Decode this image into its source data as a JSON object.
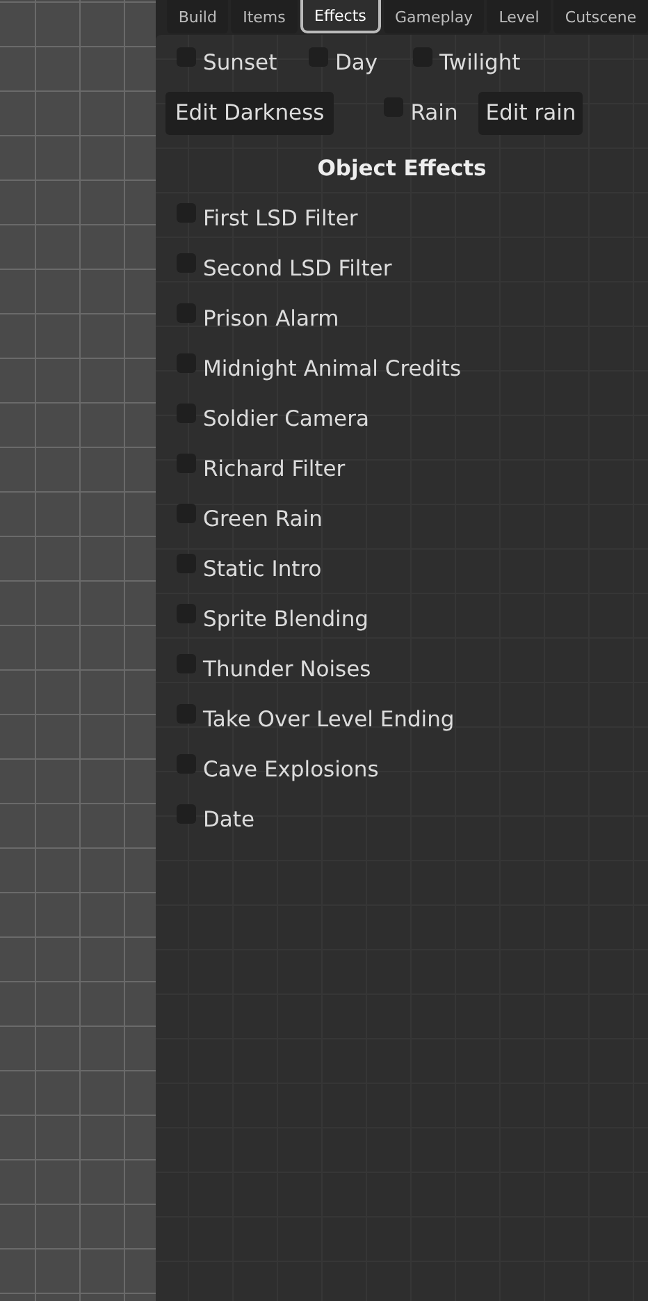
{
  "tabs": [
    {
      "label": "Build",
      "selected": false
    },
    {
      "label": "Items",
      "selected": false
    },
    {
      "label": "Effects",
      "selected": true
    },
    {
      "label": "Gameplay",
      "selected": false
    },
    {
      "label": "Level",
      "selected": false
    },
    {
      "label": "Cutscene",
      "selected": false
    }
  ],
  "time_of_day": [
    {
      "label": "Sunset",
      "checked": false
    },
    {
      "label": "Day",
      "checked": false
    },
    {
      "label": "Twilight",
      "checked": false
    }
  ],
  "darkness_button": "Edit Darkness",
  "rain": {
    "label": "Rain",
    "checked": false
  },
  "rain_button": "Edit rain",
  "object_effects_heading": "Object Effects",
  "object_effects": [
    {
      "label": "First LSD Filter",
      "checked": false
    },
    {
      "label": "Second LSD Filter",
      "checked": false
    },
    {
      "label": "Prison Alarm",
      "checked": false
    },
    {
      "label": "Midnight Animal Credits",
      "checked": false
    },
    {
      "label": "Soldier Camera",
      "checked": false
    },
    {
      "label": "Richard Filter",
      "checked": false
    },
    {
      "label": "Green Rain",
      "checked": false
    },
    {
      "label": "Static Intro",
      "checked": false
    },
    {
      "label": "Sprite Blending",
      "checked": false
    },
    {
      "label": "Thunder Noises",
      "checked": false
    },
    {
      "label": "Take Over Level Ending",
      "checked": false
    },
    {
      "label": "Cave Explosions",
      "checked": false
    },
    {
      "label": "Date",
      "checked": false
    }
  ]
}
